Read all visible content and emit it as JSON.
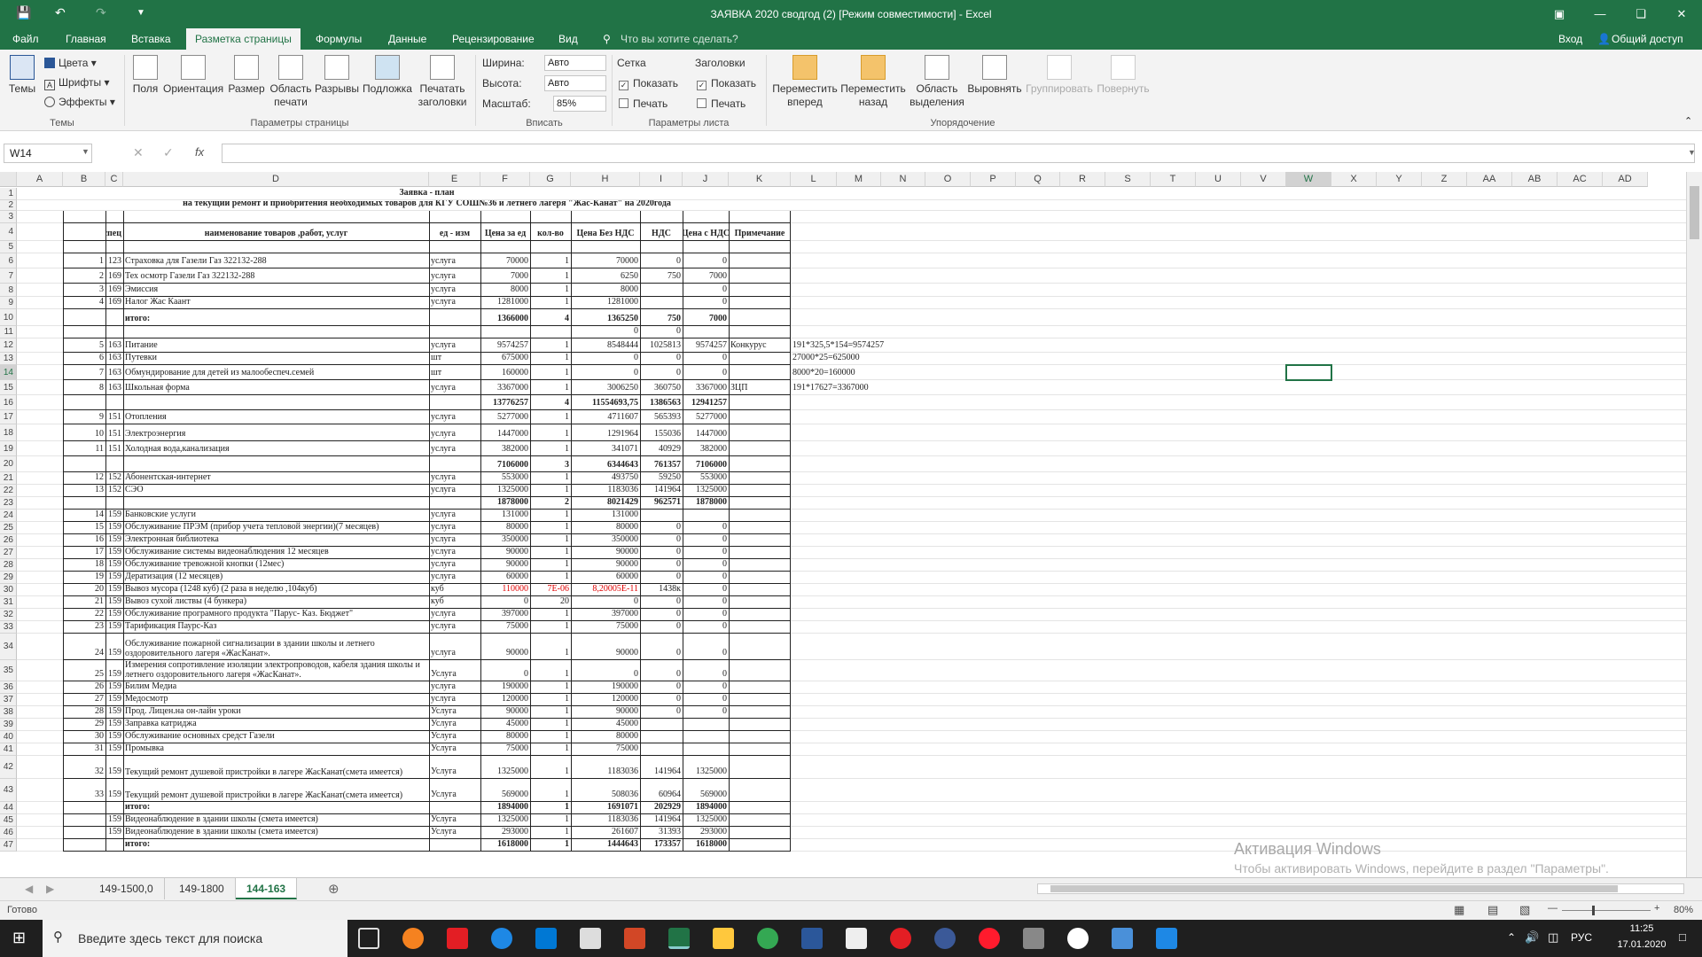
{
  "titlebar": {
    "title": "ЗАЯВКА 2020 сводгод (2)  [Режим совместимости] - Excel"
  },
  "menu": {
    "tabs": [
      "Файл",
      "Главная",
      "Вставка",
      "Разметка страницы",
      "Формулы",
      "Данные",
      "Рецензирование",
      "Вид"
    ],
    "tellme": "Что вы хотите сделать?",
    "signin": "Вход",
    "share": "Общий доступ"
  },
  "ribbon": {
    "themes": {
      "label": "Темы",
      "colors": "Цвета",
      "fonts": "Шрифты",
      "effects": "Эффекты",
      "group": "Темы"
    },
    "page": {
      "margins": "Поля",
      "orientation": "Ориентация",
      "size": "Размер",
      "print_area": "Область печати",
      "breaks": "Разрывы",
      "background": "Подложка",
      "print_titles": "Печатать заголовки",
      "group": "Параметры страницы"
    },
    "fit": {
      "width": "Ширина:",
      "width_val": "Авто",
      "height": "Высота:",
      "height_val": "Авто",
      "scale": "Масштаб:",
      "scale_val": "85%",
      "group": "Вписать"
    },
    "sheet": {
      "grid": "Сетка",
      "headings": "Заголовки",
      "show": "Показать",
      "print": "Печать",
      "group": "Параметры листа"
    },
    "arrange": {
      "forward": "Переместить вперед",
      "backward": "Переместить назад",
      "selection": "Область выделения",
      "align": "Выровнять",
      "group_btn": "Группировать",
      "rotate": "Повернуть",
      "group": "Упорядочение"
    }
  },
  "formula": {
    "namebox": "W14",
    "fx": "fx",
    "value": ""
  },
  "columns": [
    "A",
    "B",
    "C",
    "D",
    "E",
    "F",
    "G",
    "H",
    "I",
    "J",
    "K",
    "L",
    "M",
    "N",
    "O",
    "P",
    "Q",
    "R",
    "S",
    "T",
    "U",
    "V",
    "W",
    "X",
    "Y",
    "Z",
    "AA",
    "AB",
    "AC",
    "AD"
  ],
  "rows": [
    {
      "n": "1",
      "c": {
        "D": "Заявка - план"
      }
    },
    {
      "n": "2",
      "c": {
        "D": "на текущий ремонт и приобритения необходимых товаров для КГУ СОШ№36 и летнего лагеря \"Жас-Канат\"  на 2020года"
      }
    },
    {
      "n": "3",
      "c": {}
    },
    {
      "n": "4",
      "c": {
        "C": "спец",
        "D": "наименование товаров ,работ,  услуг",
        "E": "ед - изм",
        "F": "Цена за ед",
        "G": "кол-во",
        "H": "Цена Без НДС",
        "I": "НДС",
        "J": "Цена с НДС",
        "K": "Примечание"
      }
    },
    {
      "n": "5",
      "c": {}
    },
    {
      "n": "6",
      "c": {
        "B": "1",
        "C": "123",
        "D": "Страховка для Газели Газ 322132-288",
        "E": "услуга",
        "F": "70000",
        "G": "1",
        "H": "70000",
        "I": "0",
        "J": "0"
      }
    },
    {
      "n": "7",
      "c": {
        "B": "2",
        "C": "169",
        "D": "Тех осмотр  Газели Газ 322132-288",
        "E": "услуга",
        "F": "7000",
        "G": "1",
        "H": "6250",
        "I": "750",
        "J": "7000"
      }
    },
    {
      "n": "8",
      "c": {
        "B": "3",
        "C": "169",
        "D": "Эмиссия",
        "E": "услуга",
        "F": "8000",
        "G": "1",
        "H": "8000",
        "J": "0"
      }
    },
    {
      "n": "9",
      "c": {
        "B": "4",
        "C": "169",
        "D": "Налог Жас Каант",
        "E": "услуга",
        "F": "1281000",
        "G": "1",
        "H": "1281000",
        "J": "0"
      }
    },
    {
      "n": "10",
      "c": {
        "D": "итого:",
        "F": "1366000",
        "G": "4",
        "H": "1365250",
        "I": "750",
        "J": "7000"
      }
    },
    {
      "n": "11",
      "c": {
        "H": "0",
        "I": "0"
      }
    },
    {
      "n": "12",
      "c": {
        "B": "5",
        "C": "163",
        "D": "Питание",
        "E": "услуга",
        "F": "9574257",
        "G": "1",
        "H": "8548444",
        "I": "1025813",
        "J": "9574257",
        "K": "Конкурус",
        "L": "191*325,5*154=9574257"
      }
    },
    {
      "n": "13",
      "c": {
        "B": "6",
        "C": "163",
        "D": "Путевки",
        "E": "шт",
        "F": "675000",
        "G": "1",
        "H": "0",
        "I": "0",
        "J": "0",
        "L": "27000*25=625000"
      }
    },
    {
      "n": "14",
      "c": {
        "B": "7",
        "C": "163",
        "D": "Обмундирование для детей из малообеспеч.семей",
        "E": "шт",
        "F": "160000",
        "G": "1",
        "H": "0",
        "I": "0",
        "J": "0",
        "L": "8000*20=160000"
      }
    },
    {
      "n": "15",
      "c": {
        "B": "8",
        "C": "163",
        "D": "Школьная форма",
        "E": "услуга",
        "F": "3367000",
        "G": "1",
        "H": "3006250",
        "I": "360750",
        "J": "3367000",
        "K": "ЗЦП",
        "L": "191*17627=3367000"
      }
    },
    {
      "n": "16",
      "c": {
        "F": "13776257",
        "G": "4",
        "H": "11554693,75",
        "I": "1386563",
        "J": "12941257"
      }
    },
    {
      "n": "17",
      "c": {
        "B": "9",
        "C": "151",
        "D": "Отопления",
        "E": "услуга",
        "F": "5277000",
        "G": "1",
        "H": "4711607",
        "I": "565393",
        "J": "5277000"
      }
    },
    {
      "n": "18",
      "c": {
        "B": "10",
        "C": "151",
        "D": "Электроэнергия",
        "E": "услуга",
        "F": "1447000",
        "G": "1",
        "H": "1291964",
        "I": "155036",
        "J": "1447000"
      }
    },
    {
      "n": "19",
      "c": {
        "B": "11",
        "C": "151",
        "D": "Холодная вода,канализация",
        "E": "услуга",
        "F": "382000",
        "G": "1",
        "H": "341071",
        "I": "40929",
        "J": "382000"
      }
    },
    {
      "n": "20",
      "c": {
        "F": "7106000",
        "G": "3",
        "H": "6344643",
        "I": "761357",
        "J": "7106000"
      }
    },
    {
      "n": "21",
      "c": {
        "B": "12",
        "C": "152",
        "D": "Абонентская-интернет",
        "E": "услуга",
        "F": "553000",
        "G": "1",
        "H": "493750",
        "I": "59250",
        "J": "553000"
      }
    },
    {
      "n": "22",
      "c": {
        "B": "13",
        "C": "152",
        "D": "СЭО",
        "E": "услуга",
        "F": "1325000",
        "G": "1",
        "H": "1183036",
        "I": "141964",
        "J": "1325000"
      }
    },
    {
      "n": "23",
      "c": {
        "F": "1878000",
        "G": "2",
        "H": "8021429",
        "I": "962571",
        "J": "1878000"
      }
    },
    {
      "n": "24",
      "c": {
        "B": "14",
        "C": "159",
        "D": "Банковские услуги",
        "E": "услуга",
        "F": "131000",
        "G": "1",
        "H": "131000"
      }
    },
    {
      "n": "25",
      "c": {
        "B": "15",
        "C": "159",
        "D": "Обслуживание ПРЭМ (прибор учета тепловой энергии)(7 месяцев)",
        "E": "услуга",
        "F": "80000",
        "G": "1",
        "H": "80000",
        "I": "0",
        "J": "0"
      }
    },
    {
      "n": "26",
      "c": {
        "B": "16",
        "C": "159",
        "D": "Электронная библиотека",
        "E": "услуга",
        "F": "350000",
        "G": "1",
        "H": "350000",
        "I": "0",
        "J": "0"
      }
    },
    {
      "n": "27",
      "c": {
        "B": "17",
        "C": "159",
        "D": "Обслуживание системы видеонаблюдения 12 месяцев",
        "E": "услуга",
        "F": "90000",
        "G": "1",
        "H": "90000",
        "I": "0",
        "J": "0"
      }
    },
    {
      "n": "28",
      "c": {
        "B": "18",
        "C": "159",
        "D": "Обслуживание тревожной кнопки (12мес)",
        "E": "услуга",
        "F": "90000",
        "G": "1",
        "H": "90000",
        "I": "0",
        "J": "0"
      }
    },
    {
      "n": "29",
      "c": {
        "B": "19",
        "C": "159",
        "D": "Дератизация (12 месяцев)",
        "E": "услуга",
        "F": "60000",
        "G": "1",
        "H": "60000",
        "I": "0",
        "J": "0"
      }
    },
    {
      "n": "30",
      "c": {
        "B": "20",
        "C": "159",
        "D": "Вывоз мусора (1248 куб) (2 раза в неделю ,104куб)",
        "E": "куб",
        "F": "110000",
        "G": "7E-06",
        "H": "8,20005E-11",
        "I": "1438к",
        "J": "0"
      }
    },
    {
      "n": "31",
      "c": {
        "B": "21",
        "C": "159",
        "D": "Вывоз сухой листвы (4 бункера)",
        "E": "куб",
        "F": "0",
        "G": "20",
        "H": "0",
        "I": "0",
        "J": "0"
      }
    },
    {
      "n": "32",
      "c": {
        "B": "22",
        "C": "159",
        "D": "Обслуживание програмного продукта \"Парус- Каз. Бюджет\"",
        "E": "услуга",
        "F": "397000",
        "G": "1",
        "H": "397000",
        "I": "0",
        "J": "0"
      }
    },
    {
      "n": "33",
      "c": {
        "B": "23",
        "C": "159",
        "D": "Тарификация Паурс-Каз",
        "E": "услуга",
        "F": "75000",
        "G": "1",
        "H": "75000",
        "I": "0",
        "J": "0"
      }
    },
    {
      "n": "34",
      "c": {
        "B": "24",
        "C": "159",
        "D": "Обслуживание пожарной сигнализации в здании школы и летнего оздоровительного лагеря «ЖасКанат».",
        "E": "услуга",
        "F": "90000",
        "G": "1",
        "H": "90000",
        "I": "0",
        "J": "0"
      }
    },
    {
      "n": "35",
      "c": {
        "B": "25",
        "C": "159",
        "D": "Измерения сопротивление изоляции электропроводов, кабеля здания школы и летнего оздоровительного лагеря «ЖасКанат».",
        "E": "Услуга",
        "F": "0",
        "G": "1",
        "H": "0",
        "I": "0",
        "J": "0"
      }
    },
    {
      "n": "36",
      "c": {
        "B": "26",
        "C": "159",
        "D": "Билим Медиа",
        "E": "услуга",
        "F": "190000",
        "G": "1",
        "H": "190000",
        "I": "0",
        "J": "0"
      }
    },
    {
      "n": "37",
      "c": {
        "B": "27",
        "C": "159",
        "D": "Медосмотр",
        "E": "услуга",
        "F": "120000",
        "G": "1",
        "H": "120000",
        "I": "0",
        "J": "0"
      }
    },
    {
      "n": "38",
      "c": {
        "B": "28",
        "C": "159",
        "D": "Прод. Лицен.на он-лайн уроки",
        "E": "Услуга",
        "F": "90000",
        "G": "1",
        "H": "90000",
        "I": "0",
        "J": "0"
      }
    },
    {
      "n": "39",
      "c": {
        "B": "29",
        "C": "159",
        "D": "Заправка катриджа",
        "E": "Услуга",
        "F": "45000",
        "G": "1",
        "H": "45000"
      }
    },
    {
      "n": "40",
      "c": {
        "B": "30",
        "C": "159",
        "D": "Обслуживание основных средст Газели",
        "E": "Услуга",
        "F": "80000",
        "G": "1",
        "H": "80000"
      }
    },
    {
      "n": "41",
      "c": {
        "B": "31",
        "C": "159",
        "D": "Промывка",
        "E": "Услуга",
        "F": "75000",
        "G": "1",
        "H": "75000"
      }
    },
    {
      "n": "42",
      "c": {
        "B": "32",
        "C": "159",
        "D": "Текущий ремонт душевой пристройки в лагере ЖасКанат(смета имеется)",
        "E": "Услуга",
        "F": "1325000",
        "G": "1",
        "H": "1183036",
        "I": "141964",
        "J": "1325000"
      }
    },
    {
      "n": "43",
      "c": {
        "B": "33",
        "C": "159",
        "D": "Текущий ремонт душевой пристройки в лагере ЖасКанат(смета имеется)",
        "E": "Услуга",
        "F": "569000",
        "G": "1",
        "H": "508036",
        "I": "60964",
        "J": "569000"
      }
    },
    {
      "n": "44",
      "c": {
        "D": "итого:",
        "F": "1894000",
        "G": "1",
        "H": "1691071",
        "I": "202929",
        "J": "1894000"
      }
    },
    {
      "n": "45",
      "c": {
        "C": "159",
        "D": "Видеонаблюдение в здании школы (смета имеется)",
        "E": "Услуга",
        "F": "1325000",
        "G": "1",
        "H": "1183036",
        "I": "141964",
        "J": "1325000"
      }
    },
    {
      "n": "46",
      "c": {
        "C": "159",
        "D": "Видеонаблюдение в здании школы (смета имеется)",
        "E": "Услуга",
        "F": "293000",
        "G": "1",
        "H": "261607",
        "I": "31393",
        "J": "293000"
      }
    },
    {
      "n": "47",
      "c": {
        "D": "итого:",
        "F": "1618000",
        "G": "1",
        "H": "1444643",
        "I": "173357",
        "J": "1618000"
      }
    }
  ],
  "sheets": [
    "149-1500,0",
    "149-1800",
    "144-163"
  ],
  "statusbar": {
    "ready": "Готово",
    "zoom": "80%"
  },
  "watermark": {
    "title": "Активация Windows",
    "text": "Чтобы активировать Windows, перейдите в раздел \"Параметры\"."
  },
  "taskbar": {
    "search": "Введите здесь текст для поиска",
    "lang": "РУС",
    "time": "11:25",
    "date": "17.01.2020"
  }
}
